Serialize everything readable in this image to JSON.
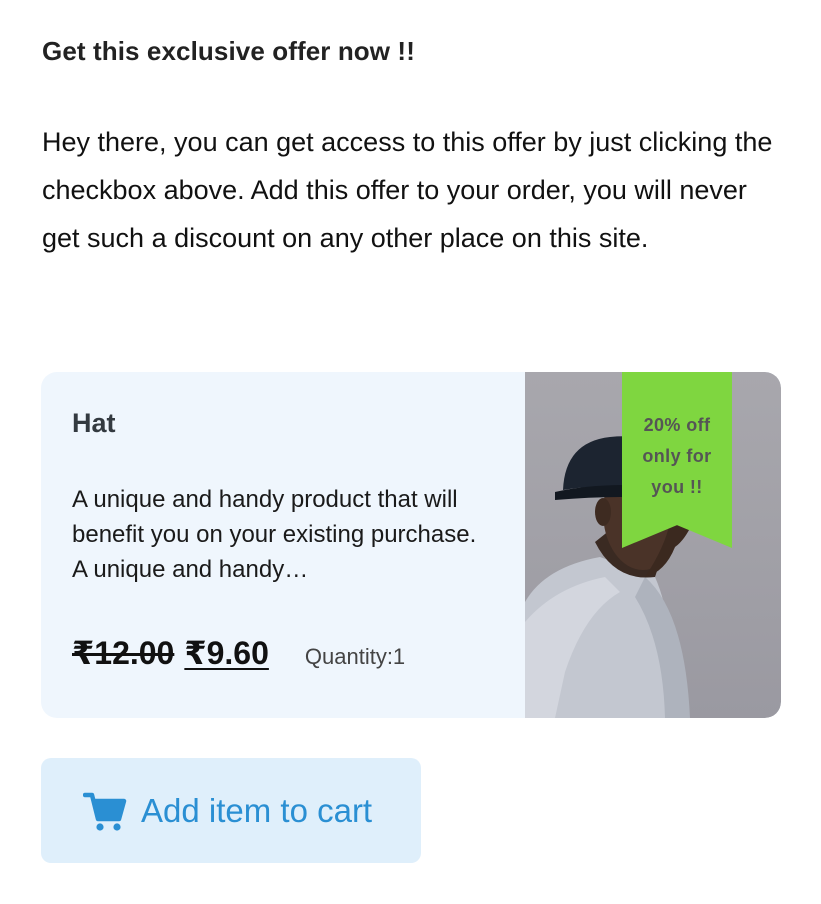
{
  "offer": {
    "heading": "Get this exclusive offer now !!",
    "description": "Hey there, you can get access to this offer by just clicking the checkbox above. Add this offer to your order, you will never get such a discount on any other place on this site."
  },
  "product": {
    "title": "Hat",
    "description": "A unique and handy product that will benefit you on your existing purchase. A unique and handy…",
    "price_old": "₹12.00",
    "price_new": "₹9.60",
    "quantity": "Quantity:1",
    "ribbon": "20% off only for you !!"
  },
  "button": {
    "label": "Add item to cart",
    "icon": "cart-icon"
  },
  "colors": {
    "card_background": "#eff6fd",
    "ribbon": "#7fd640",
    "button_background": "#dfeffb",
    "button_text": "#2a8fd3"
  }
}
